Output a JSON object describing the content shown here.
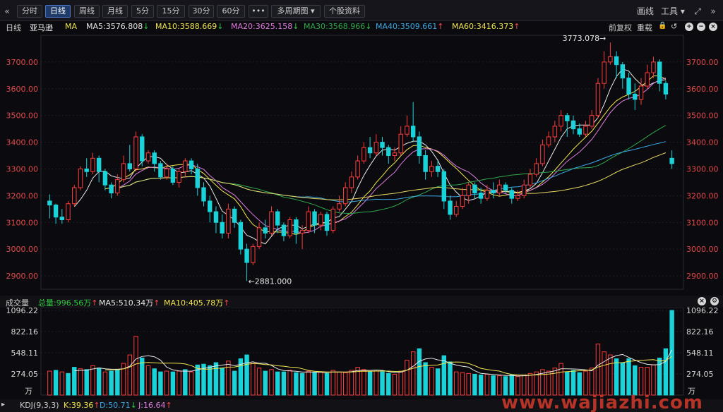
{
  "toolbar": {
    "back_icon": "double-chevron-left-icon",
    "buttons": [
      "分时",
      "日线",
      "周线",
      "月线",
      "5分",
      "15分",
      "30分",
      "60分",
      "•••",
      "多周期图 ▾",
      "个股资料"
    ],
    "active": "日线",
    "right": {
      "draw": "画线",
      "tools": "工具 ▾"
    },
    "icons": [
      "expand-icon",
      "double-chevron-right-icon"
    ]
  },
  "ma_bar": {
    "period": "日线",
    "name": "亚马逊",
    "indicator": "MA",
    "items": [
      {
        "label": "MA5:3576.808",
        "dir": "↓",
        "color": "#e8e8e8",
        "arrow": "#2ecc40"
      },
      {
        "label": "MA10:3588.669",
        "dir": "↓",
        "color": "#f2e64d",
        "arrow": "#2ecc40"
      },
      {
        "label": "MA20:3625.158",
        "dir": "↓",
        "color": "#e07be0",
        "arrow": "#2ecc40"
      },
      {
        "label": "MA30:3568.966",
        "dir": "↓",
        "color": "#2ea84a",
        "arrow": "#2ecc40"
      },
      {
        "label": "MA40:3509.661",
        "dir": "↑",
        "color": "#3aa9e6",
        "arrow": "#ff4a4a"
      },
      {
        "label": "MA60:3416.373",
        "dir": "↑",
        "color": "#f2e64d",
        "arrow": "#ff4a4a"
      }
    ],
    "right_labels": [
      "前复权",
      "重载"
    ]
  },
  "price_axis": {
    "ticks": [
      "3700.00",
      "3600.00",
      "3500.00",
      "3400.00",
      "3300.00",
      "3200.00",
      "3100.00",
      "3000.00",
      "2900.00"
    ]
  },
  "annotations": {
    "high": "3773.078→",
    "low": "←2881.000"
  },
  "volume_bar": {
    "title": "成交量",
    "items": [
      {
        "label": "总量:996.56万",
        "dir": "↑",
        "color": "#2ecc40",
        "arrow": "#ff4a4a"
      },
      {
        "label": "MA5:510.34万",
        "dir": "↑",
        "color": "#e8e8e8",
        "arrow": "#ff4a4a"
      },
      {
        "label": "MA10:405.78万",
        "dir": "↑",
        "color": "#f2e64d",
        "arrow": "#ff4a4a"
      }
    ]
  },
  "volume_axis": {
    "ticks": [
      "1096.22",
      "822.16",
      "548.11",
      "274.05"
    ],
    "unit": "万"
  },
  "kdj_bar": {
    "title": "KDJ(9,3,3)",
    "items": [
      {
        "label": "K:39.36",
        "dir": "↑",
        "color": "#f2e64d",
        "arrow": "#ff4a4a"
      },
      {
        "label": "D:50.71",
        "dir": "↓",
        "color": "#3aa9e6",
        "arrow": "#2ecc40"
      },
      {
        "label": "J:16.64",
        "dir": "↑",
        "color": "#e07be0",
        "arrow": "#ff4a4a"
      }
    ]
  },
  "watermark": "www.wajiazhi.com",
  "colors": {
    "up": "#ff3b3b",
    "down": "#19d3d9",
    "grid": "#1f1f27"
  },
  "chart_data": {
    "type": "candlestick",
    "ylim": [
      2850,
      3800
    ],
    "candles": [
      [
        3180,
        3165,
        3205,
        3115
      ],
      [
        3165,
        3120,
        3170,
        3095
      ],
      [
        3120,
        3110,
        3150,
        3095
      ],
      [
        3110,
        3170,
        3180,
        3100
      ],
      [
        3170,
        3230,
        3240,
        3160
      ],
      [
        3230,
        3300,
        3310,
        3220
      ],
      [
        3300,
        3290,
        3340,
        3270
      ],
      [
        3290,
        3340,
        3360,
        3280
      ],
      [
        3340,
        3290,
        3350,
        3250
      ],
      [
        3290,
        3240,
        3300,
        3220
      ],
      [
        3240,
        3210,
        3250,
        3190
      ],
      [
        3210,
        3260,
        3280,
        3200
      ],
      [
        3260,
        3320,
        3350,
        3250
      ],
      [
        3320,
        3300,
        3390,
        3290
      ],
      [
        3300,
        3420,
        3440,
        3290
      ],
      [
        3420,
        3330,
        3430,
        3310
      ],
      [
        3330,
        3360,
        3370,
        3320
      ],
      [
        3360,
        3320,
        3370,
        3290
      ],
      [
        3320,
        3270,
        3330,
        3260
      ],
      [
        3270,
        3300,
        3320,
        3260
      ],
      [
        3300,
        3250,
        3310,
        3240
      ],
      [
        3250,
        3290,
        3300,
        3230
      ],
      [
        3290,
        3330,
        3340,
        3270
      ],
      [
        3330,
        3300,
        3340,
        3280
      ],
      [
        3300,
        3230,
        3320,
        3200
      ],
      [
        3230,
        3180,
        3250,
        3160
      ],
      [
        3180,
        3140,
        3200,
        3100
      ],
      [
        3140,
        3100,
        3160,
        3060
      ],
      [
        3100,
        3060,
        3130,
        3040
      ],
      [
        3060,
        3150,
        3170,
        3040
      ],
      [
        3150,
        3100,
        3160,
        3080
      ],
      [
        3100,
        3000,
        3110,
        2980
      ],
      [
        3000,
        2950,
        3020,
        2881
      ],
      [
        2950,
        3010,
        3020,
        2940
      ],
      [
        3010,
        3080,
        3100,
        3000
      ],
      [
        3080,
        3060,
        3110,
        3040
      ],
      [
        3060,
        3140,
        3160,
        3050
      ],
      [
        3140,
        3090,
        3150,
        3060
      ],
      [
        3090,
        3050,
        3100,
        3030
      ],
      [
        3050,
        3110,
        3120,
        3040
      ],
      [
        3110,
        3060,
        3120,
        3020
      ],
      [
        3060,
        3070,
        3090,
        3000
      ],
      [
        3070,
        3140,
        3160,
        3060
      ],
      [
        3140,
        3090,
        3150,
        3060
      ],
      [
        3090,
        3130,
        3140,
        3070
      ],
      [
        3130,
        3070,
        3140,
        3050
      ],
      [
        3070,
        3150,
        3160,
        3060
      ],
      [
        3150,
        3170,
        3200,
        3140
      ],
      [
        3170,
        3230,
        3250,
        3160
      ],
      [
        3230,
        3270,
        3290,
        3210
      ],
      [
        3270,
        3330,
        3350,
        3260
      ],
      [
        3330,
        3380,
        3400,
        3320
      ],
      [
        3380,
        3360,
        3420,
        3340
      ],
      [
        3360,
        3400,
        3430,
        3350
      ],
      [
        3400,
        3380,
        3420,
        3350
      ],
      [
        3380,
        3350,
        3390,
        3320
      ],
      [
        3350,
        3360,
        3380,
        3330
      ],
      [
        3360,
        3430,
        3460,
        3350
      ],
      [
        3430,
        3460,
        3500,
        3420
      ],
      [
        3460,
        3420,
        3550,
        3400
      ],
      [
        3420,
        3350,
        3440,
        3320
      ],
      [
        3350,
        3290,
        3370,
        3260
      ],
      [
        3290,
        3310,
        3330,
        3270
      ],
      [
        3310,
        3290,
        3330,
        3270
      ],
      [
        3290,
        3180,
        3300,
        3150
      ],
      [
        3180,
        3130,
        3200,
        3110
      ],
      [
        3130,
        3160,
        3180,
        3120
      ],
      [
        3160,
        3200,
        3230,
        3150
      ],
      [
        3200,
        3240,
        3250,
        3170
      ],
      [
        3240,
        3210,
        3250,
        3190
      ],
      [
        3210,
        3190,
        3230,
        3170
      ],
      [
        3190,
        3220,
        3240,
        3180
      ],
      [
        3220,
        3210,
        3250,
        3190
      ],
      [
        3210,
        3240,
        3260,
        3200
      ],
      [
        3240,
        3220,
        3250,
        3210
      ],
      [
        3220,
        3190,
        3230,
        3170
      ],
      [
        3190,
        3200,
        3220,
        3180
      ],
      [
        3200,
        3240,
        3260,
        3190
      ],
      [
        3240,
        3280,
        3300,
        3230
      ],
      [
        3280,
        3320,
        3340,
        3270
      ],
      [
        3320,
        3390,
        3410,
        3310
      ],
      [
        3390,
        3420,
        3440,
        3380
      ],
      [
        3420,
        3460,
        3480,
        3400
      ],
      [
        3460,
        3500,
        3520,
        3440
      ],
      [
        3500,
        3480,
        3510,
        3420
      ],
      [
        3480,
        3450,
        3500,
        3430
      ],
      [
        3450,
        3430,
        3470,
        3420
      ],
      [
        3430,
        3460,
        3480,
        3420
      ],
      [
        3460,
        3500,
        3520,
        3450
      ],
      [
        3500,
        3620,
        3640,
        3490
      ],
      [
        3620,
        3700,
        3740,
        3600
      ],
      [
        3700,
        3720,
        3773,
        3690
      ],
      [
        3720,
        3690,
        3740,
        3640
      ],
      [
        3690,
        3640,
        3700,
        3600
      ],
      [
        3640,
        3580,
        3660,
        3560
      ],
      [
        3580,
        3560,
        3620,
        3520
      ],
      [
        3560,
        3610,
        3640,
        3540
      ],
      [
        3610,
        3660,
        3690,
        3600
      ],
      [
        3660,
        3700,
        3720,
        3640
      ],
      [
        3700,
        3620,
        3710,
        3590
      ],
      [
        3620,
        3580,
        3630,
        3560
      ],
      [
        3340,
        3320,
        3370,
        3300
      ]
    ],
    "volume": [
      [
        310,
        1
      ],
      [
        320,
        0
      ],
      [
        300,
        1
      ],
      [
        280,
        0
      ],
      [
        360,
        0
      ],
      [
        340,
        1
      ],
      [
        330,
        0
      ],
      [
        380,
        1
      ],
      [
        350,
        0
      ],
      [
        300,
        1
      ],
      [
        310,
        0
      ],
      [
        330,
        0
      ],
      [
        410,
        1
      ],
      [
        520,
        1
      ],
      [
        760,
        1
      ],
      [
        480,
        0
      ],
      [
        380,
        1
      ],
      [
        340,
        0
      ],
      [
        300,
        0
      ],
      [
        310,
        1
      ],
      [
        300,
        0
      ],
      [
        310,
        1
      ],
      [
        330,
        0
      ],
      [
        300,
        1
      ],
      [
        390,
        0
      ],
      [
        400,
        0
      ],
      [
        380,
        0
      ],
      [
        420,
        0
      ],
      [
        350,
        0
      ],
      [
        440,
        1
      ],
      [
        310,
        0
      ],
      [
        470,
        0
      ],
      [
        520,
        0
      ],
      [
        410,
        1
      ],
      [
        350,
        1
      ],
      [
        310,
        0
      ],
      [
        330,
        1
      ],
      [
        300,
        0
      ],
      [
        300,
        0
      ],
      [
        320,
        1
      ],
      [
        290,
        0
      ],
      [
        280,
        0
      ],
      [
        310,
        1
      ],
      [
        290,
        0
      ],
      [
        300,
        1
      ],
      [
        280,
        0
      ],
      [
        320,
        1
      ],
      [
        300,
        1
      ],
      [
        290,
        1
      ],
      [
        320,
        1
      ],
      [
        360,
        1
      ],
      [
        330,
        1
      ],
      [
        300,
        0
      ],
      [
        310,
        1
      ],
      [
        300,
        0
      ],
      [
        280,
        0
      ],
      [
        270,
        1
      ],
      [
        310,
        1
      ],
      [
        450,
        1
      ],
      [
        560,
        1
      ],
      [
        600,
        0
      ],
      [
        420,
        0
      ],
      [
        360,
        1
      ],
      [
        340,
        0
      ],
      [
        510,
        0
      ],
      [
        430,
        0
      ],
      [
        300,
        1
      ],
      [
        290,
        1
      ],
      [
        280,
        1
      ],
      [
        270,
        0
      ],
      [
        260,
        0
      ],
      [
        270,
        1
      ],
      [
        250,
        0
      ],
      [
        250,
        1
      ],
      [
        240,
        0
      ],
      [
        260,
        0
      ],
      [
        240,
        1
      ],
      [
        260,
        1
      ],
      [
        280,
        1
      ],
      [
        300,
        1
      ],
      [
        330,
        1
      ],
      [
        310,
        1
      ],
      [
        350,
        1
      ],
      [
        410,
        1
      ],
      [
        300,
        0
      ],
      [
        320,
        0
      ],
      [
        290,
        0
      ],
      [
        310,
        1
      ],
      [
        350,
        1
      ],
      [
        660,
        1
      ],
      [
        560,
        1
      ],
      [
        520,
        1
      ],
      [
        470,
        0
      ],
      [
        420,
        0
      ],
      [
        470,
        0
      ],
      [
        380,
        0
      ],
      [
        360,
        1
      ],
      [
        360,
        1
      ],
      [
        390,
        1
      ],
      [
        480,
        0
      ],
      [
        600,
        0
      ],
      [
        1096,
        0
      ]
    ]
  }
}
